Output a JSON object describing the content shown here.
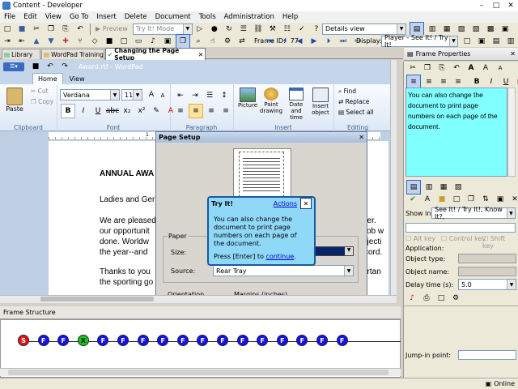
{
  "window": {
    "title": "Content - Developer"
  },
  "menu": [
    "File",
    "Edit",
    "View",
    "Go To",
    "Insert",
    "Delete",
    "Document",
    "Tools",
    "Administration",
    "Help"
  ],
  "toolbar": {
    "preview_label": "Preview",
    "mode_value": "Try It! Mode",
    "view_value": "Details view",
    "frame_id_label": "Frame ID:",
    "frame_id_value": "77",
    "display_label": "Display:",
    "display_value": "Player - See It! / Try It!"
  },
  "doc_tabs": [
    {
      "label": "Library"
    },
    {
      "label": "WordPad Training"
    },
    {
      "label": "Changing the Page Setup"
    }
  ],
  "wordpad": {
    "title": "Award.rtf - WordPad",
    "tabs": [
      "Home",
      "View"
    ],
    "font_name": "Verdana",
    "font_size": "11",
    "paste_label": "Paste",
    "cut_label": "Cut",
    "copy_label": "Copy",
    "picture_label": "Picture",
    "paint_label1": "Paint",
    "paint_label2": "drawing",
    "datetime_label1": "Date and",
    "datetime_label2": "time",
    "insertobj_label1": "Insert",
    "insertobj_label2": "object",
    "find_label": "Find",
    "replace_label": "Replace",
    "selectall_label": "Select all",
    "groups": [
      "Clipboard",
      "Font",
      "Paragraph",
      "Insert",
      "Editing"
    ],
    "doc_lines": {
      "heading": "ANNUAL AWA",
      "salutation": "Ladies and Ger",
      "p1_l1": "We are pleased",
      "p1_l1_right": "ner.",
      "p1_l2": "our opportunit",
      "p1_l2_right": "ob w",
      "p1_l3": "done.  Worldw",
      "p1_l3_right": "bjecti",
      "p1_l4": "the year--and",
      "p1_l4_right": "cord.",
      "p2_l1": "Thanks to you",
      "p2_l1_right": "ortan",
      "p2_l2": "the sporting go"
    }
  },
  "page_setup": {
    "title": "Page Setup",
    "paper_label": "Paper",
    "size_label": "Size:",
    "source_label": "Source:",
    "source_value": "Rear Tray",
    "orientation_label": "Orientation",
    "margins_label": "Margins (inches)"
  },
  "tryit": {
    "title": "Try It!",
    "actions_label": "Actions",
    "message": "You can also change the document to print page numbers on each page of the document.",
    "prompt_prefix": "Press [Enter] to ",
    "prompt_link": "continue",
    "prompt_suffix": "."
  },
  "frame_structure": {
    "title": "Frame Structure",
    "nodes": [
      "S",
      "F",
      "F",
      "X",
      "F",
      "F",
      "F",
      "F",
      "F",
      "F",
      "F",
      "F",
      "F",
      "F",
      "F",
      "F",
      "F"
    ]
  },
  "frame_properties": {
    "title": "Frame Properties",
    "bubble_text": "You can also change the document to print page numbers on each page of the document.",
    "show_in_label": "Show in:",
    "show_in_value": "See It! / Try It!, Know It?,",
    "alt_key": "Alt key",
    "control_key": "Control key",
    "shift_key": "Shift key",
    "application_label": "Application:",
    "object_type_label": "Object type:",
    "object_name_label": "Object name:",
    "delay_label": "Delay time (s):",
    "delay_value": "5.0",
    "jump_in_label": "Jump-in point:"
  },
  "status": {
    "online": "Online"
  },
  "colors": {
    "bubble_bg": "#80ffff",
    "tryit_bg": "#8fd8f8",
    "node_blue": "#1414e6",
    "node_red": "#e61414",
    "node_green": "#14c814",
    "select_blue": "#0a246a"
  }
}
